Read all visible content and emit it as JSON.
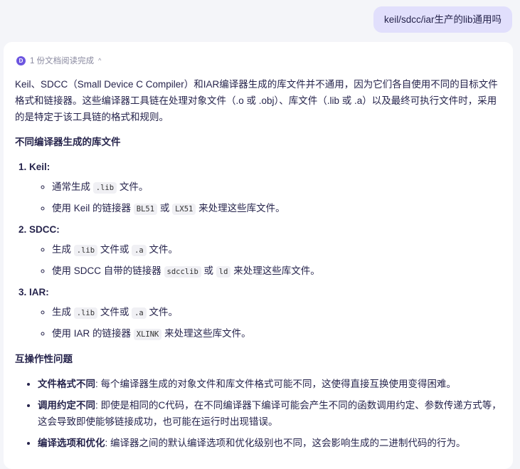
{
  "user_message": "keil/sdcc/iar生产的lib通用吗",
  "docs_status": {
    "icon": "D",
    "label": "1 份文档阅读完成"
  },
  "intro": "Keil、SDCC（Small Device C Compiler）和IAR编译器生成的库文件并不通用，因为它们各自使用不同的目标文件格式和链接器。这些编译器工具链在处理对象文件（.o 或 .obj）、库文件（.lib 或 .a）以及最终可执行文件时，采用的是特定于该工具链的格式和规则。",
  "heading1": "不同编译器生成的库文件",
  "compilers": [
    {
      "name": "Keil:",
      "items": [
        [
          "通常生成 ",
          ".lib",
          " 文件。",
          "",
          ""
        ],
        [
          "使用 Keil 的链接器 ",
          "BL51",
          " 或 ",
          "LX51",
          " 来处理这些库文件。"
        ]
      ]
    },
    {
      "name": "SDCC:",
      "items": [
        [
          "生成 ",
          ".lib",
          " 文件或 ",
          ".a",
          " 文件。"
        ],
        [
          "使用 SDCC 自带的链接器 ",
          "sdcclib",
          " 或 ",
          "ld",
          " 来处理这些库文件。"
        ]
      ]
    },
    {
      "name": "IAR:",
      "items": [
        [
          "生成 ",
          ".lib",
          " 文件或 ",
          ".a",
          " 文件。"
        ],
        [
          "使用 IAR 的链接器 ",
          "XLINK",
          " 来处理这些库文件。",
          "",
          ""
        ]
      ]
    }
  ],
  "heading2": "互操作性问题",
  "issues": [
    {
      "title": "文件格式不同",
      "text": ": 每个编译器生成的对象文件和库文件格式可能不同，这使得直接互换使用变得困难。"
    },
    {
      "title": "调用约定不同",
      "text": ": 即使是相同的C代码，在不同编译器下编译可能会产生不同的函数调用约定、参数传递方式等，这会导致即使能够链接成功，也可能在运行时出现错误。"
    },
    {
      "title": "编译选项和优化",
      "text": ": 编译器之间的默认编译选项和优化级别也不同，这会影响生成的二进制代码的行为。"
    }
  ]
}
